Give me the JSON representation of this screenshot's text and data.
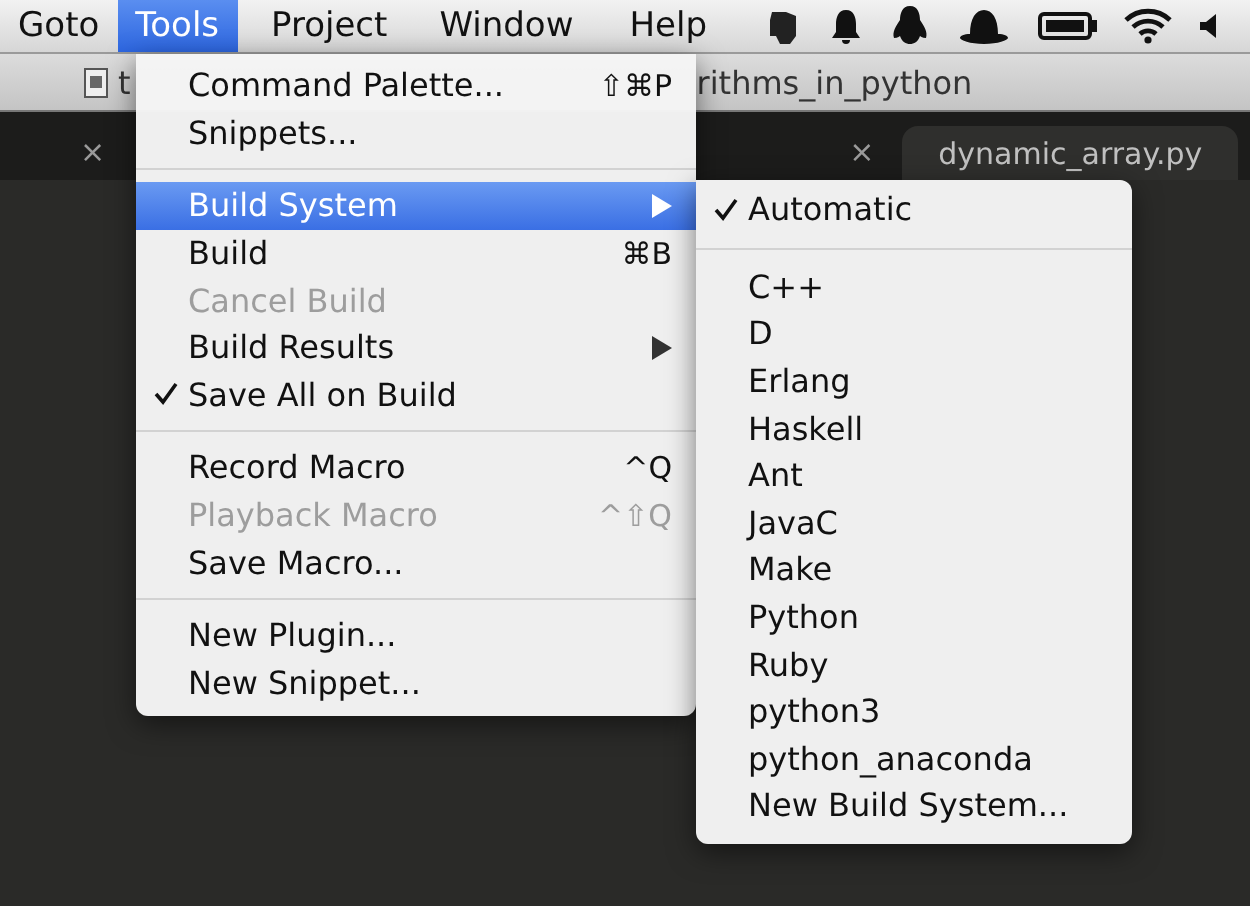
{
  "menubar": {
    "menus": [
      {
        "label": "Goto",
        "selected": false
      },
      {
        "label": "Tools",
        "selected": true
      },
      {
        "label": "Project",
        "selected": false
      },
      {
        "label": "Window",
        "selected": false
      },
      {
        "label": "Help",
        "selected": false
      }
    ]
  },
  "title_bar": {
    "title_start": "t",
    "title_end": "rithms_in_python"
  },
  "tabs": [
    {
      "close": "×"
    },
    {
      "close": "×"
    },
    {
      "label": "dynamic_array.py"
    }
  ],
  "tools_menu": [
    {
      "kind": "item",
      "label": "Command Palette...",
      "shortcut": "⇧⌘P"
    },
    {
      "kind": "item",
      "label": "Snippets..."
    },
    {
      "kind": "separator"
    },
    {
      "kind": "item",
      "label": "Build System",
      "selected": true,
      "has_submenu": true
    },
    {
      "kind": "item",
      "label": "Build",
      "shortcut": "⌘B"
    },
    {
      "kind": "item",
      "label": "Cancel Build",
      "disabled": true
    },
    {
      "kind": "item",
      "label": "Build Results",
      "has_submenu": true
    },
    {
      "kind": "item",
      "label": "Save All on Build",
      "checked": true
    },
    {
      "kind": "separator"
    },
    {
      "kind": "item",
      "label": "Record Macro",
      "shortcut": "^Q"
    },
    {
      "kind": "item",
      "label": "Playback Macro",
      "shortcut": "^⇧Q",
      "disabled": true
    },
    {
      "kind": "item",
      "label": "Save Macro..."
    },
    {
      "kind": "separator"
    },
    {
      "kind": "item",
      "label": "New Plugin..."
    },
    {
      "kind": "item",
      "label": "New Snippet..."
    }
  ],
  "build_system_menu": [
    {
      "kind": "item",
      "label": "Automatic",
      "checked": true
    },
    {
      "kind": "separator"
    },
    {
      "kind": "item",
      "label": "C++",
      "checked": false
    },
    {
      "kind": "item",
      "label": "D",
      "checked": false
    },
    {
      "kind": "item",
      "label": "Erlang",
      "checked": false
    },
    {
      "kind": "item",
      "label": "Haskell",
      "checked": false
    },
    {
      "kind": "item",
      "label": "Ant",
      "checked": false
    },
    {
      "kind": "item",
      "label": "JavaC",
      "checked": false
    },
    {
      "kind": "item",
      "label": "Make",
      "checked": false
    },
    {
      "kind": "item",
      "label": "Python",
      "checked": false
    },
    {
      "kind": "item",
      "label": "Ruby",
      "checked": false
    },
    {
      "kind": "item",
      "label": "python3",
      "checked": false
    },
    {
      "kind": "item",
      "label": "python_anaconda",
      "checked": false
    },
    {
      "kind": "item",
      "label": "New Build System...",
      "checked": false
    }
  ]
}
